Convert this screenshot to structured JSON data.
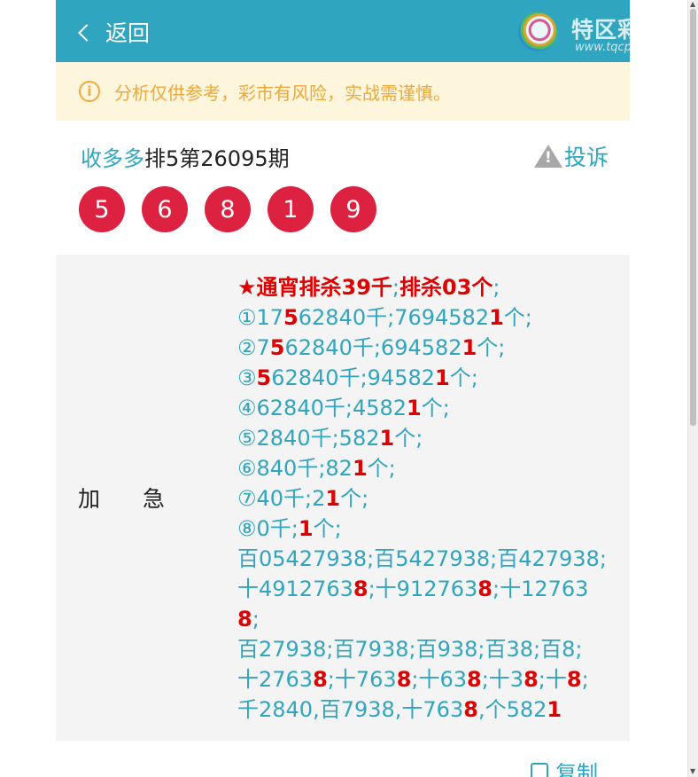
{
  "header": {
    "back_label": "返回",
    "logo_text": "特区彩票网",
    "logo_sub": "www.tqcp.net"
  },
  "notice": {
    "icon": "info-circle-icon",
    "text": "分析仅供参考，彩市有风险，实战需谨慎。"
  },
  "post": {
    "author": "收多多",
    "period": "排5第26095期",
    "complain_label": "投诉",
    "balls": [
      "5",
      "6",
      "8",
      "1",
      "9"
    ]
  },
  "content": {
    "label_1": "加",
    "label_2": "急",
    "lines": [
      [
        {
          "t": "★通宵排杀39千",
          "r": true
        },
        {
          "t": ";"
        },
        {
          "t": "排杀03个",
          "r": true
        },
        {
          "t": ";"
        }
      ],
      [
        {
          "t": "①17"
        },
        {
          "t": "5",
          "r": true
        },
        {
          "t": "62840千;7694582"
        },
        {
          "t": "1",
          "r": true
        },
        {
          "t": "个;"
        }
      ],
      [
        {
          "t": "②7"
        },
        {
          "t": "5",
          "r": true
        },
        {
          "t": "62840千;694582"
        },
        {
          "t": "1",
          "r": true
        },
        {
          "t": "个;"
        }
      ],
      [
        {
          "t": "③"
        },
        {
          "t": "5",
          "r": true
        },
        {
          "t": "62840千;94582"
        },
        {
          "t": "1",
          "r": true
        },
        {
          "t": "个;"
        }
      ],
      [
        {
          "t": "④62840千;4582"
        },
        {
          "t": "1",
          "r": true
        },
        {
          "t": "个;"
        }
      ],
      [
        {
          "t": "⑤2840千;582"
        },
        {
          "t": "1",
          "r": true
        },
        {
          "t": "个;"
        }
      ],
      [
        {
          "t": "⑥840千;82"
        },
        {
          "t": "1",
          "r": true
        },
        {
          "t": "个;"
        }
      ],
      [
        {
          "t": "⑦40千;2"
        },
        {
          "t": "1",
          "r": true
        },
        {
          "t": "个;"
        }
      ],
      [
        {
          "t": "⑧0千;"
        },
        {
          "t": "1",
          "r": true
        },
        {
          "t": "个;"
        }
      ],
      [
        {
          "t": "百05427938;百5427938;百427938;"
        }
      ],
      [
        {
          "t": "十4912763"
        },
        {
          "t": "8",
          "r": true
        },
        {
          "t": ";十912763"
        },
        {
          "t": "8",
          "r": true
        },
        {
          "t": ";十12763"
        }
      ],
      [
        {
          "t": "8",
          "r": true
        },
        {
          "t": ";"
        }
      ],
      [
        {
          "t": "百27938;百7938;百938;百38;百8;"
        }
      ],
      [
        {
          "t": "十2763"
        },
        {
          "t": "8",
          "r": true
        },
        {
          "t": ";十763"
        },
        {
          "t": "8",
          "r": true
        },
        {
          "t": ";十63"
        },
        {
          "t": "8",
          "r": true
        },
        {
          "t": ";十3"
        },
        {
          "t": "8",
          "r": true
        },
        {
          "t": ";十"
        },
        {
          "t": "8",
          "r": true
        },
        {
          "t": ";"
        }
      ],
      [
        {
          "t": "千2840,百7938,十763"
        },
        {
          "t": "8",
          "r": true
        },
        {
          "t": ",个582"
        },
        {
          "t": "1",
          "r": true
        }
      ]
    ]
  },
  "footer": {
    "copy_label": "复制"
  },
  "colors": {
    "brand": "#2fa5c0",
    "ball": "#dc2240",
    "highlight": "#e00000",
    "notice_text": "#efa83a"
  }
}
